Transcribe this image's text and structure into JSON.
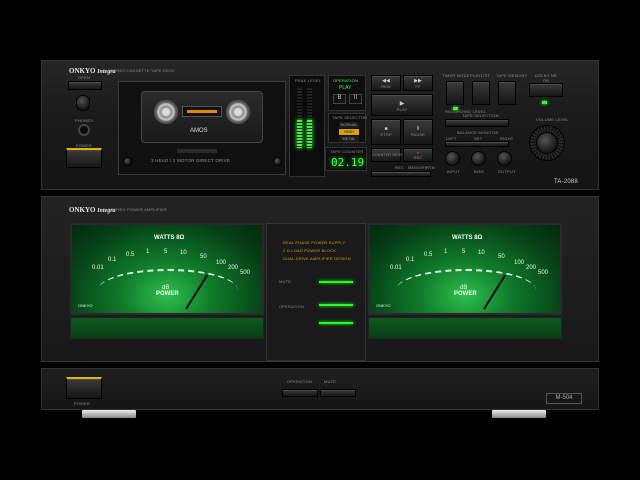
{
  "deck": {
    "brand": "ONKYO",
    "brand_sub": "Integra",
    "model_desc": "STEREO CASSETTE TAPE DECK",
    "model": "TA-2088",
    "left_labels": {
      "open": "OPEN",
      "phones": "PHONES",
      "power": "POWER"
    },
    "cassette": {
      "label": "AMOS",
      "head_text": "3 HEAD / 2 MOTOR DIRECT DRIVE"
    },
    "peak_level_label": "PEAK LEVEL",
    "operation": {
      "title": "OPERATION",
      "play": "PLAY",
      "nr": "B",
      "sub": [
        "ON",
        "NR",
        "TYPE"
      ],
      "sub_vals": [
        "B",
        "II"
      ]
    },
    "tape_selector": {
      "title": "TAPE SELECTOR",
      "options": [
        "NORMAL",
        "HIGH",
        "METAL"
      ]
    },
    "tape_counter": {
      "title": "TAPE COUNTER",
      "value": "02.19"
    },
    "transport": {
      "buttons": [
        {
          "glyph": "◀◀",
          "label": "REW"
        },
        {
          "glyph": "▶▶",
          "label": "FF"
        },
        {
          "glyph": "▶",
          "label": "PLAY"
        },
        {
          "glyph": "■",
          "label": "STOP"
        },
        {
          "glyph": "●",
          "label": "REC"
        },
        {
          "glyph": "II",
          "label": "PAUSE"
        }
      ],
      "counter_reset": "COUNTER RESET",
      "bottom": [
        "REC",
        "MEMORY",
        "RTN"
      ]
    },
    "top_switches": [
      "TIMER MODE",
      "PLAYLIST",
      "TAPE MEMORY"
    ],
    "dolby": {
      "title": "DOLBY NR",
      "sub": "ON"
    },
    "record_level": {
      "title": "RECORDING LEVEL"
    },
    "tape_selection": {
      "title": "TAPE SELECTION"
    },
    "balance": {
      "title": "BALANCE MONITOR",
      "labels": [
        "LEFT",
        "SET",
        "RIGHT"
      ],
      "knobs": [
        "INPUT",
        "BIAS",
        "OUTPUT"
      ]
    },
    "volume_label": "VOLUME LEVEL"
  },
  "amp": {
    "brand": "ONKYO",
    "brand_sub": "Integra",
    "model_desc": "STEREO POWER AMPLIFIER",
    "meters": [
      {
        "title": "WATTS 8Ω",
        "bottom": "POWER",
        "db": "dB",
        "brand": "ONKYO",
        "scale": [
          "0.01",
          "0.1",
          "0.5",
          "1",
          "5",
          "10",
          "50",
          "100",
          "200",
          "500"
        ]
      },
      {
        "title": "WATTS 8Ω",
        "bottom": "POWER",
        "db": "dB",
        "brand": "ONKYO",
        "scale": [
          "0.01",
          "0.1",
          "0.5",
          "1",
          "5",
          "10",
          "50",
          "100",
          "200",
          "500"
        ]
      }
    ],
    "center_text": [
      "REAL PHASE POWER SUPPLY",
      "2 Ω LOAD POWER BLOCK",
      "DUAL DRIVE AMPLIFIER DESIGN"
    ],
    "center_mute": "MUTE",
    "center_operation": "OPERATION",
    "power_label": "POWER",
    "buttons": [
      "OPERATION",
      "MUTE"
    ],
    "model": "M-504"
  }
}
